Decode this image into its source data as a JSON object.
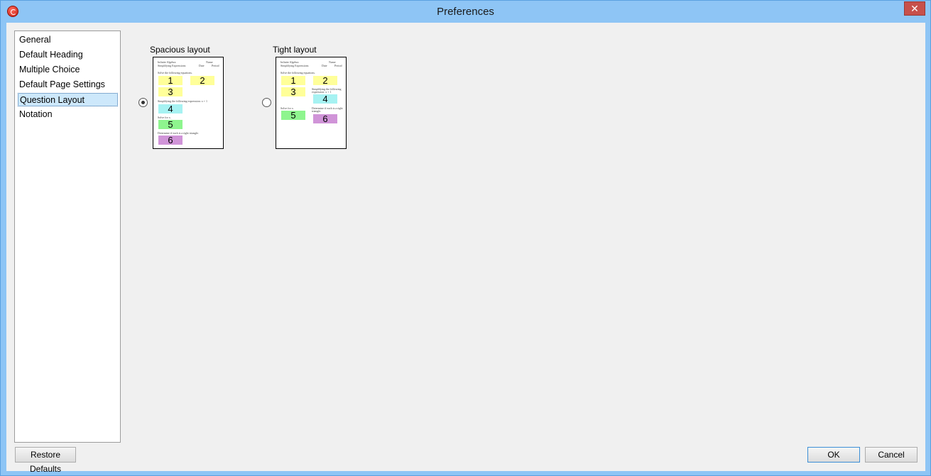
{
  "window": {
    "title": "Preferences",
    "close_glyph": "✕",
    "app_icon": "app-icon"
  },
  "nav": {
    "items": [
      {
        "label": "General"
      },
      {
        "label": "Default Heading"
      },
      {
        "label": "Multiple Choice"
      },
      {
        "label": "Default Page Settings"
      },
      {
        "label": "Question Layout",
        "selected": true
      },
      {
        "label": "Notation"
      }
    ]
  },
  "layouts": {
    "spacious": {
      "label": "Spacious layout",
      "selected": true,
      "preview": {
        "header_left_1": "Infinite Algebra",
        "header_left_2": "Simplifying Expressions",
        "header_right_1": "Name",
        "header_right_2": "Date",
        "header_right_3": "Period",
        "instr_1": "Solve the following equations.",
        "instr_2": "Simplifying the following expression: x + 1",
        "instr_3": "Solve for x.",
        "instr_4": "Determine if each is a right triangle.",
        "q1": "1",
        "q2": "2",
        "q3": "3",
        "q4": "4",
        "q5": "5",
        "q6": "6"
      }
    },
    "tight": {
      "label": "Tight layout",
      "selected": false,
      "preview": {
        "header_left_1": "Infinite Algebra",
        "header_left_2": "Simplifying Expressions",
        "header_right_1": "Name",
        "header_right_2": "Date",
        "header_right_3": "Period",
        "instr_1": "Solve the following equations.",
        "instr_2": "Simplifying the following expression: x + 1",
        "instr_3": "Solve for x.",
        "instr_4": "Determine if each is a right triangle.",
        "q1": "1",
        "q2": "2",
        "q3": "3",
        "q4": "4",
        "q5": "5",
        "q6": "6"
      }
    }
  },
  "buttons": {
    "restore": "Restore Defaults",
    "ok": "OK",
    "cancel": "Cancel"
  },
  "colors": {
    "titlebar": "#8ec5f5",
    "selection": "#cde8fb",
    "q_yellow": "#ffff99",
    "q_cyan": "#a6f2f2",
    "q_green": "#8ef58e",
    "q_purple": "#d094d8"
  }
}
